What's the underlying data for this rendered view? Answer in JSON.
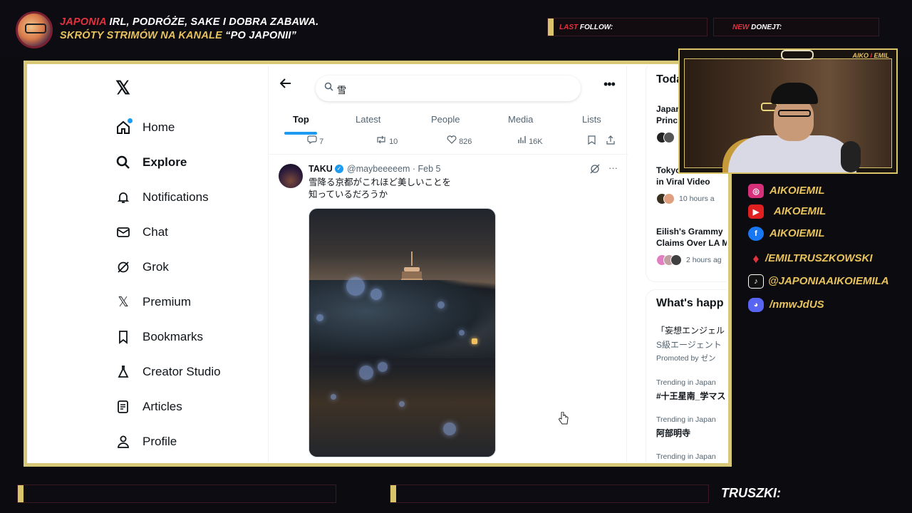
{
  "overlay": {
    "headline1_red": "JAPONIA",
    "headline1_rest": " IRL, PODRÓŻE, SAKE I DOBRA ZABAWA.",
    "headline2_a": "SKRÓTY STRIMÓW NA KANALE ",
    "headline2_b": "“PO JAPONII”",
    "last_follow_label_a": "LAST ",
    "last_follow_label_b": "FOLLOW:",
    "new_donate_label_a": "NEW ",
    "new_donate_label_b": "DONEJT:",
    "cam_title_a": "AIKO",
    "cam_title_sep": " I ",
    "cam_title_b": "EMIL",
    "truszki": "TRUSZKI:",
    "socials": [
      {
        "icon": "instagram-icon",
        "text": "AIKOIEMIL",
        "color": "#d6307a"
      },
      {
        "icon": "youtube-icon",
        "text": "AIKOEMIL",
        "color": "#e02020"
      },
      {
        "icon": "facebook-icon",
        "text": "AIKOIEMIL",
        "color": "#1877f2"
      },
      {
        "icon": "patronite-icon",
        "text": "/EMILTRUSZKOWSKI",
        "color": "#e2323e"
      },
      {
        "icon": "tiktok-icon",
        "text": "@JAPONIAAIKOIEMILA",
        "color": "#111111"
      },
      {
        "icon": "discord-icon",
        "text": "/nmwJdUS",
        "color": "#5865f2"
      }
    ]
  },
  "x": {
    "nav": [
      {
        "label": "Home",
        "icon": "home-icon"
      },
      {
        "label": "Explore",
        "icon": "search-icon"
      },
      {
        "label": "Notifications",
        "icon": "bell-icon"
      },
      {
        "label": "Chat",
        "icon": "mail-icon"
      },
      {
        "label": "Grok",
        "icon": "grok-icon"
      },
      {
        "label": "Premium",
        "icon": "x-logo-icon"
      },
      {
        "label": "Bookmarks",
        "icon": "bookmark-icon"
      },
      {
        "label": "Creator Studio",
        "icon": "flask-icon"
      },
      {
        "label": "Articles",
        "icon": "article-icon"
      },
      {
        "label": "Profile",
        "icon": "person-icon"
      }
    ],
    "search_value": "雪",
    "tabs": [
      "Top",
      "Latest",
      "People",
      "Media",
      "Lists"
    ],
    "prev_actions": {
      "replies": "7",
      "reposts": "10",
      "likes": "826",
      "views": "16K"
    },
    "tweet": {
      "name": "TAKU",
      "handle": "@maybeeeeem · Feb 5",
      "line1": "雪降る京都がこれほど美しいことを",
      "line2": "知っているだろうか"
    },
    "right": {
      "today_title": "Toda",
      "news": [
        {
          "title1": "Japan",
          "title2": "Princ",
          "meta": ""
        },
        {
          "title1": "Tokyo Police Wra",
          "title2": "in Viral Video",
          "meta": "10 hours a"
        },
        {
          "title1": "Eilish's Grammy",
          "title2": "Claims Over LA M",
          "meta": "2 hours ag"
        }
      ],
      "happening_title": "What's happ",
      "promo_title": "「妄想エンジェル",
      "promo_sub": "S級エージェント",
      "promo_meta": "Promoted by ゼン",
      "trend1_meta": "Trending in Japan",
      "trend1_title": "#十王星南_学マス",
      "trend2_meta": "Trending in Japan",
      "trend2_title": "阿部明寺",
      "trend3_meta": "Trending in Japan"
    }
  }
}
